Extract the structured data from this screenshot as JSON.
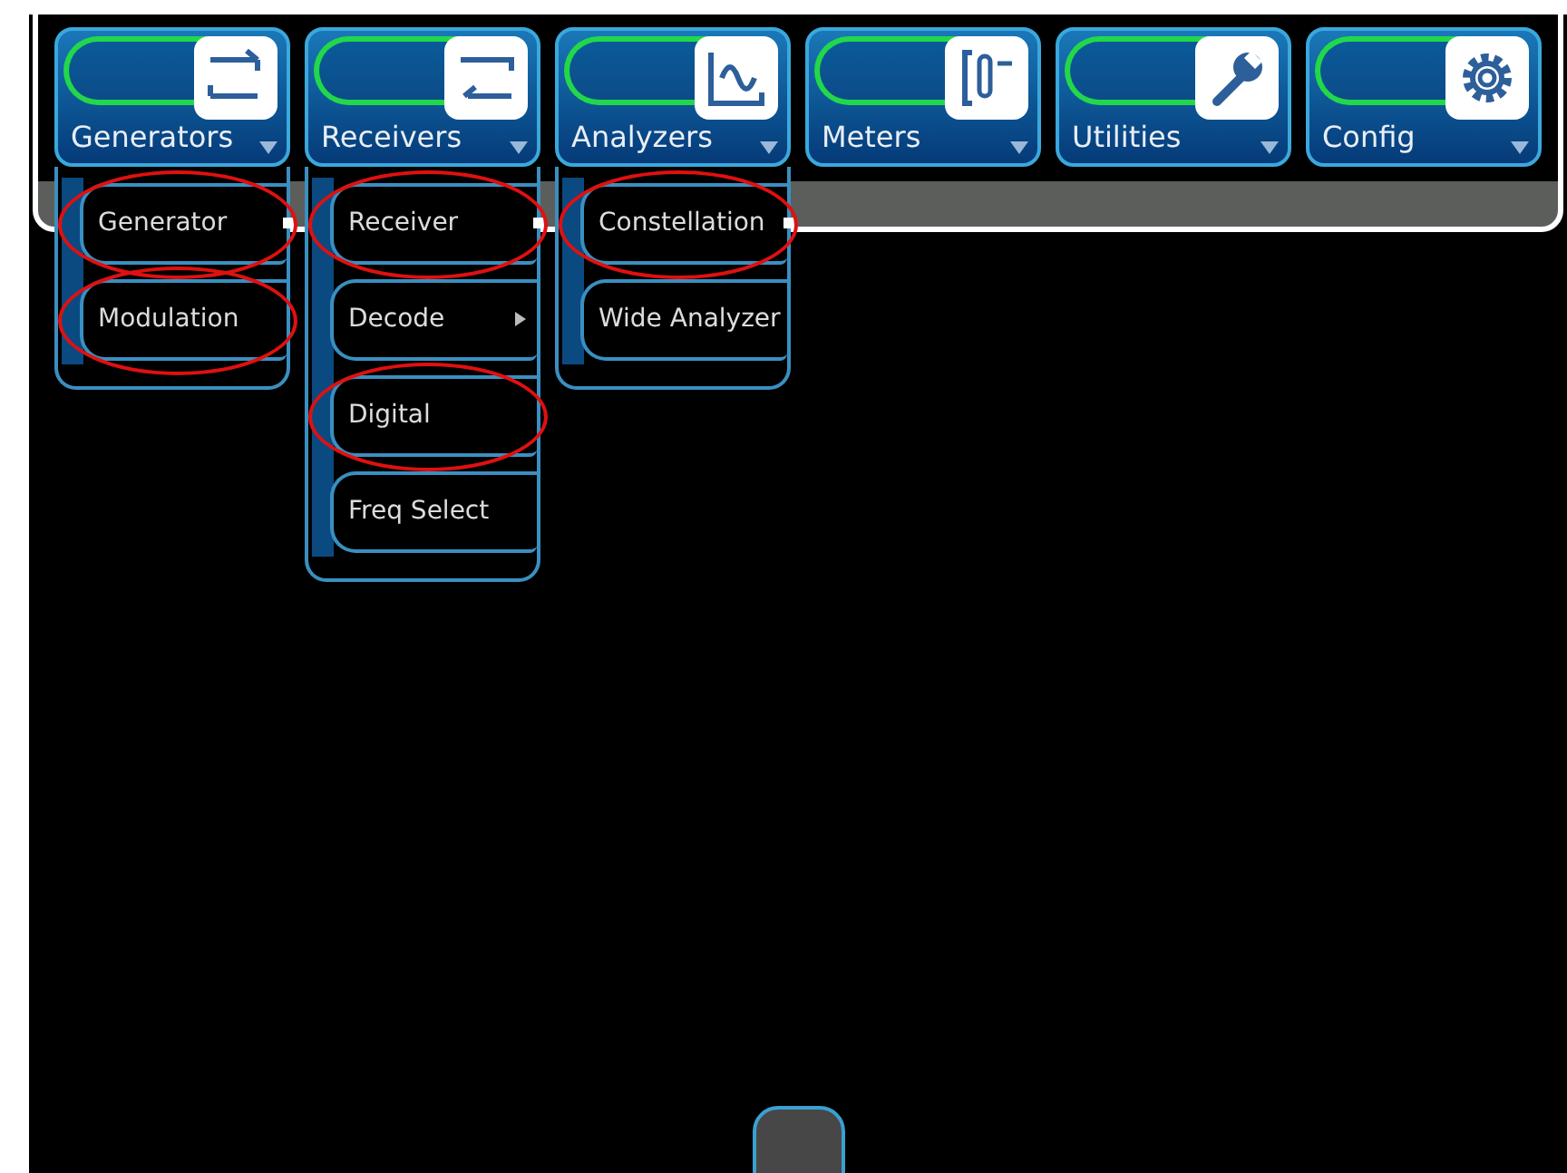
{
  "toolbar": [
    {
      "label": "Generators",
      "kind": "loop"
    },
    {
      "label": "Receivers",
      "kind": "return"
    },
    {
      "label": "Analyzers",
      "kind": "wave"
    },
    {
      "label": "Meters",
      "kind": "meter"
    },
    {
      "label": "Utilities",
      "kind": "wrench"
    },
    {
      "label": "Config",
      "kind": "gear"
    }
  ],
  "menus": [
    {
      "items": [
        {
          "label": "Generator",
          "selected": true,
          "circled": true,
          "submenu": false
        },
        {
          "label": "Modulation",
          "selected": false,
          "circled": true,
          "submenu": false
        }
      ]
    },
    {
      "items": [
        {
          "label": "Receiver",
          "selected": true,
          "circled": true,
          "submenu": false
        },
        {
          "label": "Decode",
          "selected": false,
          "circled": false,
          "submenu": true
        },
        {
          "label": "Digital",
          "selected": false,
          "circled": true,
          "submenu": false
        },
        {
          "label": "Freq Select",
          "selected": false,
          "circled": false,
          "submenu": false
        }
      ]
    },
    {
      "items": [
        {
          "label": "Constellation",
          "selected": true,
          "circled": true,
          "submenu": false
        },
        {
          "label": "Wide Analyzer",
          "selected": false,
          "circled": false,
          "submenu": false
        }
      ]
    }
  ]
}
